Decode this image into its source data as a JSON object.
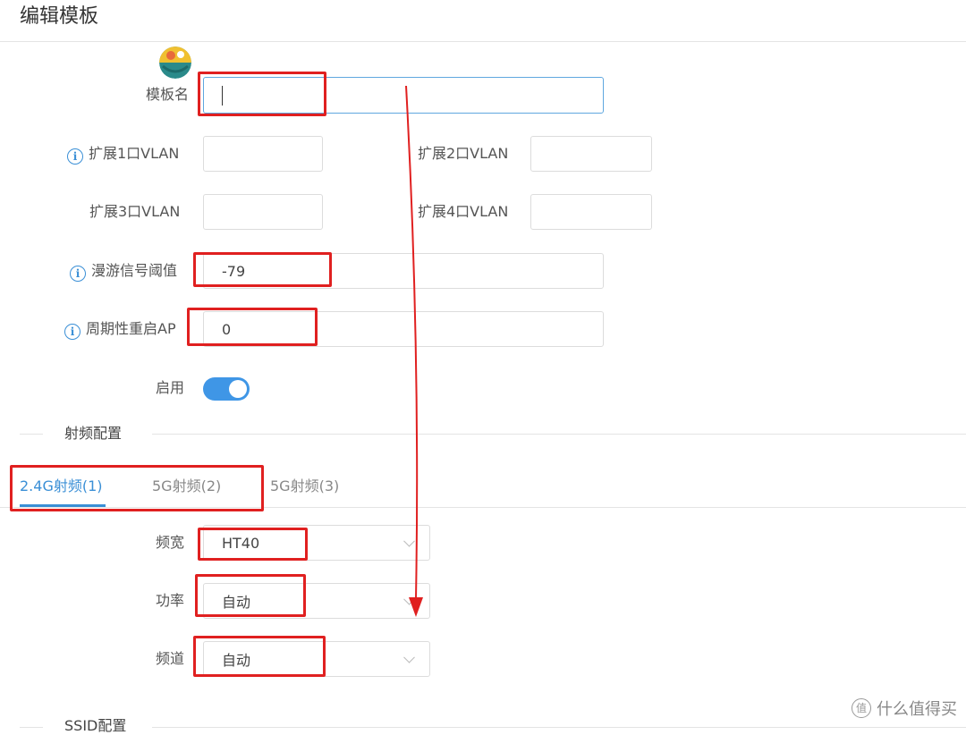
{
  "page_title": "编辑模板",
  "template_name": {
    "label": "模板名",
    "value": ""
  },
  "ext1_vlan": {
    "label": "扩展1口VLAN",
    "value": ""
  },
  "ext2_vlan": {
    "label": "扩展2口VLAN",
    "value": ""
  },
  "ext3_vlan": {
    "label": "扩展3口VLAN",
    "value": ""
  },
  "ext4_vlan": {
    "label": "扩展4口VLAN",
    "value": ""
  },
  "roaming_threshold": {
    "label": "漫游信号阈值",
    "value": "-79"
  },
  "periodic_restart": {
    "label": "周期性重启AP",
    "value": "0"
  },
  "enable": {
    "label": "启用",
    "on": true
  },
  "radio_section": {
    "title": "射频配置"
  },
  "tabs": [
    {
      "label": "2.4G射频(1)",
      "active": true
    },
    {
      "label": "5G射频(2)",
      "active": false
    },
    {
      "label": "5G射频(3)",
      "active": false
    }
  ],
  "bandwidth": {
    "label": "频宽",
    "value": "HT40"
  },
  "power": {
    "label": "功率",
    "value": "自动"
  },
  "channel": {
    "label": "频道",
    "value": "自动"
  },
  "ssid_section": {
    "title": "SSID配置"
  },
  "watermark": {
    "text": "什么值得买",
    "icon_text": "值"
  },
  "colors": {
    "accent": "#3a8fd6",
    "annotation": "#e02020",
    "toggle": "#3f96e6"
  }
}
